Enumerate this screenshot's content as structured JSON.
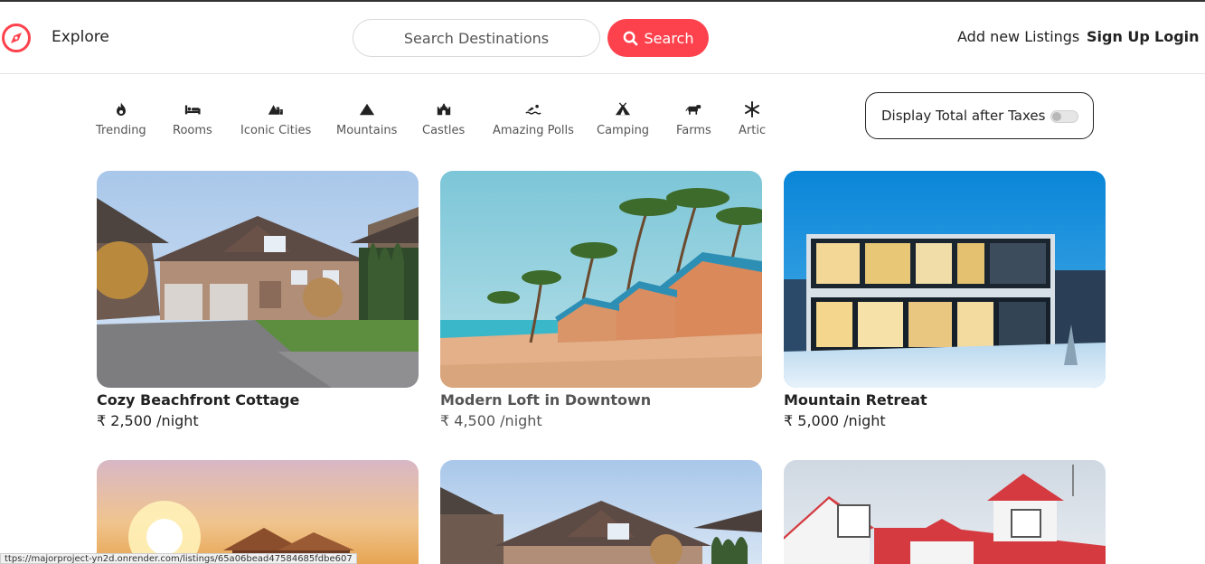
{
  "navbar": {
    "logo_icon": "compass-icon",
    "brand_color": "#fe424d",
    "explore_label": "Explore",
    "search_placeholder": "Search Destinations",
    "search_button_label": "Search",
    "add_listing_label": "Add new Listings",
    "signup_label": "Sign Up",
    "login_label": "Login"
  },
  "filters": [
    {
      "label": "Trending",
      "icon": "fire-icon"
    },
    {
      "label": "Rooms",
      "icon": "bed-icon"
    },
    {
      "label": "Iconic Cities",
      "icon": "mountain-city-icon"
    },
    {
      "label": "Mountains",
      "icon": "mountain-icon"
    },
    {
      "label": "Castles",
      "icon": "castle-icon"
    },
    {
      "label": "Amazing Polls",
      "icon": "swimmer-icon"
    },
    {
      "label": "Camping",
      "icon": "campground-icon"
    },
    {
      "label": "Farms",
      "icon": "cow-icon"
    },
    {
      "label": "Artic",
      "icon": "snowflake-icon"
    }
  ],
  "tax_toggle": {
    "label": "Display Total after Taxes",
    "enabled": false
  },
  "listings": [
    {
      "title": "Cozy Beachfront Cottage",
      "price": "₹ 2,500 /night",
      "image": "suburban-house"
    },
    {
      "title": "Modern Loft in Downtown",
      "price": "₹ 4,500 /night",
      "image": "beach-huts-palms"
    },
    {
      "title": "Mountain Retreat",
      "price": "₹ 5,000 /night",
      "image": "modern-glass-house-snow"
    },
    {
      "title": "",
      "price": "",
      "image": "sunset-house"
    },
    {
      "title": "",
      "price": "",
      "image": "suburban-house"
    },
    {
      "title": "",
      "price": "",
      "image": "red-roof-house"
    }
  ],
  "status_bar": {
    "url": "ttps://majorproject-yn2d.onrender.com/listings/65a06bead47584685fdbe607"
  }
}
